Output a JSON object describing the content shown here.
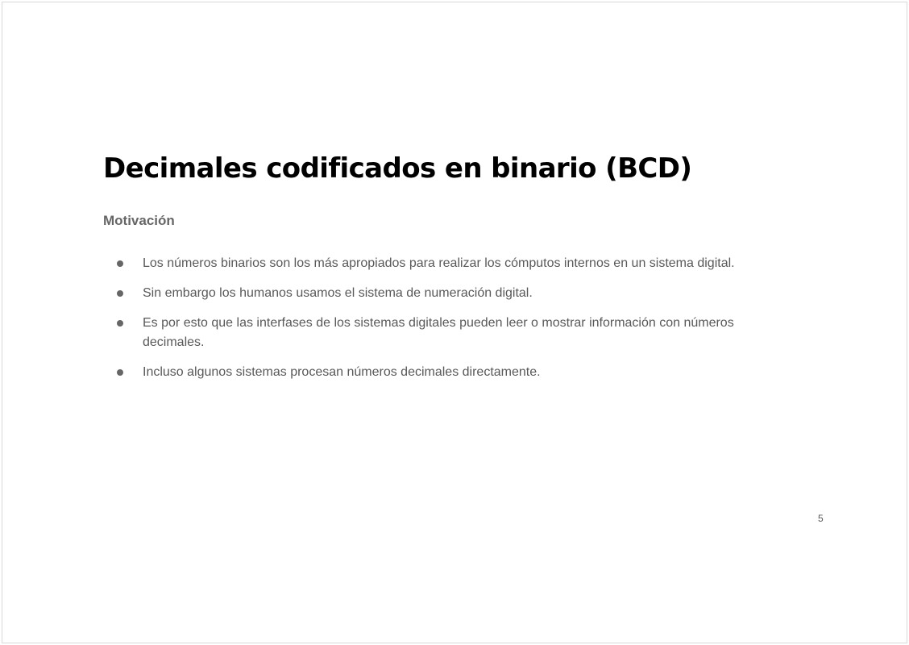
{
  "slide": {
    "title": "Decimales codificados en binario (BCD)",
    "subtitle": "Motivación",
    "bullets": [
      "Los números binarios son los más apropiados para realizar los cómputos internos en un sistema digital.",
      "Sin embargo los humanos usamos el sistema de numeración digital.",
      "Es por esto que las interfases de los sistemas digitales pueden leer o mostrar información con números decimales.",
      "Incluso algunos sistemas procesan números decimales directamente."
    ],
    "page_number": "5"
  }
}
